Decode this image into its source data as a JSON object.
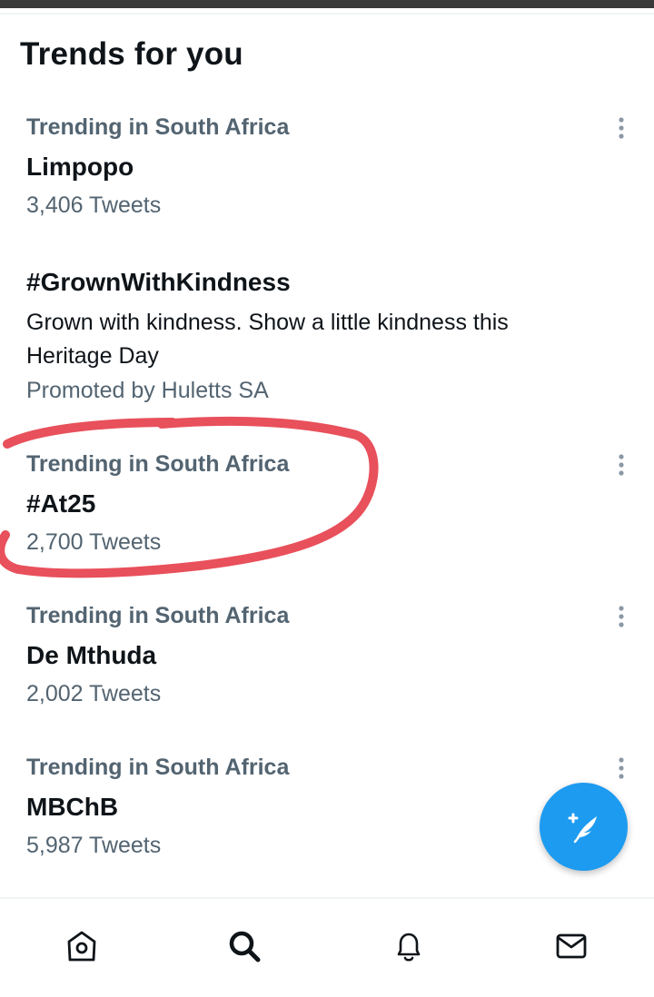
{
  "header": {
    "title": "Trends for you"
  },
  "trends": [
    {
      "context": "Trending in South Africa",
      "name": "Limpopo",
      "count": "3,406 Tweets"
    },
    {
      "context": "Trending in South Africa",
      "name": "#At25",
      "count": "2,700 Tweets"
    },
    {
      "context": "Trending in South Africa",
      "name": "De Mthuda",
      "count": "2,002 Tweets"
    },
    {
      "context": "Trending in South Africa",
      "name": "MBChB",
      "count": "5,987 Tweets"
    }
  ],
  "promoted": {
    "name": "#GrownWithKindness",
    "description": "Grown with kindness. Show a little kindness this Heritage Day",
    "promoted_by": "Promoted by Huletts SA"
  },
  "icons": {
    "more": "more-vertical-icon",
    "compose": "compose-tweet-icon",
    "home": "home-icon",
    "search": "search-icon",
    "notifications": "bell-icon",
    "messages": "envelope-icon"
  },
  "colors": {
    "accent": "#1d9bf0",
    "annotation": "#e8505b",
    "secondary_text": "#536471",
    "primary_text": "#0f1419"
  }
}
